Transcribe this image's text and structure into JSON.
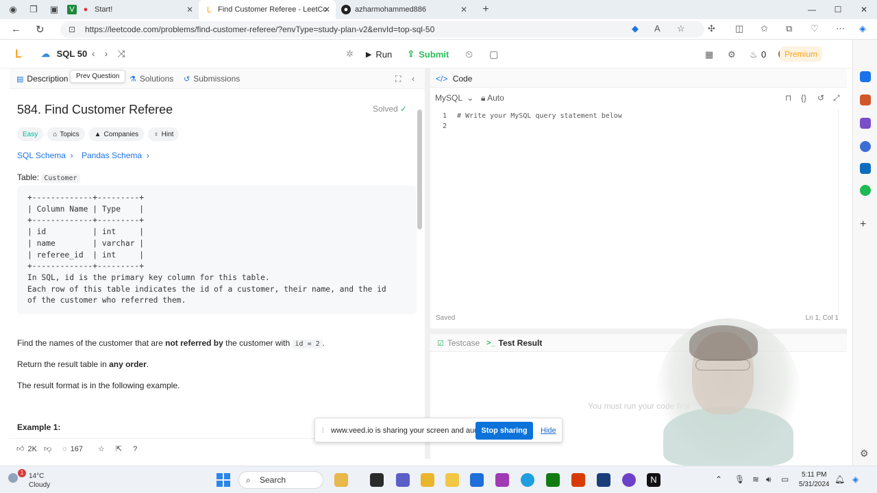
{
  "browser": {
    "tabs": [
      {
        "label": "Start!",
        "active": false
      },
      {
        "label": "Find Customer Referee - LeetCo",
        "active": true
      },
      {
        "label": "azharmohammed886",
        "active": false
      }
    ],
    "url": "https://leetcode.com/problems/find-customer-referee/?envType=study-plan-v2&envId=top-sql-50"
  },
  "leetcode": {
    "study_list": "SQL 50",
    "run_label": "Run",
    "submit_label": "Submit",
    "streak_count": "0",
    "premium_label": "Premium"
  },
  "left_tabs": {
    "description": "Description",
    "tooltip": "Prev Question",
    "solutions": "Solutions",
    "submissions": "Submissions"
  },
  "problem": {
    "title": "584. Find Customer Referee",
    "status": "Solved",
    "difficulty": "Easy",
    "chips": [
      "Topics",
      "Companies",
      "Hint"
    ],
    "schema_links": [
      "SQL Schema",
      "Pandas Schema"
    ],
    "table_label": "Table:",
    "table_name": "Customer",
    "schema_block": "+-------------+---------+\n| Column Name | Type    |\n+-------------+---------+\n| id          | int     |\n| name        | varchar |\n| referee_id  | int     |\n+-------------+---------+\nIn SQL, id is the primary key column for this table.\nEach row of this table indicates the id of a customer, their name, and the id\nof the customer who referred them.",
    "para1_pre": "Find the names of the customer that are ",
    "para1_bold": "not referred by",
    "para1_mid": " the customer with ",
    "para1_code": "id = 2",
    "para1_end": ".",
    "para2_pre": "Return the result table in ",
    "para2_bold": "any order",
    "para2_end": ".",
    "para3": "The result format is in the following example.",
    "example_heading": "Example 1:",
    "likes": "2K",
    "comments": "167"
  },
  "code": {
    "header": "Code",
    "language": "MySQL",
    "mode": "Auto",
    "lines": [
      "# Write your MySQL query statement below",
      ""
    ],
    "saved": "Saved",
    "cursor": "Ln 1, Col 1"
  },
  "test": {
    "tab_testcase": "Testcase",
    "tab_result": "Test Result",
    "empty_message": "You must run your code first"
  },
  "share_banner": {
    "message": "www.veed.io is sharing your screen and audio.",
    "stop": "Stop sharing",
    "hide": "Hide"
  },
  "taskbar": {
    "badge": "1",
    "temperature": "14°C",
    "weather": "Cloudy",
    "search": "Search",
    "time": "5:11 PM",
    "date": "5/31/2024"
  }
}
